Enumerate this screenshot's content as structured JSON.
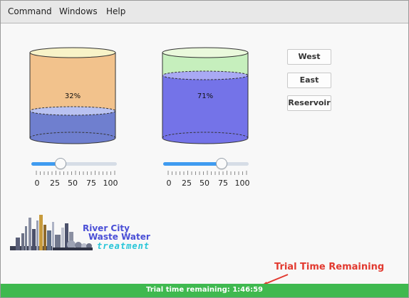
{
  "menubar": {
    "items": [
      {
        "label": "Command"
      },
      {
        "label": "Windows"
      },
      {
        "label": "Help"
      }
    ]
  },
  "tanks": [
    {
      "name": "west-tank",
      "percent_label": "32%",
      "level": 0.32,
      "colors": {
        "liquid": "#6f7fcf",
        "liquid_top": "#aab5ee",
        "empty": "#f2c28c",
        "rim": "#f7f2c4"
      }
    },
    {
      "name": "east-tank",
      "percent_label": "71%",
      "level": 0.71,
      "colors": {
        "liquid": "#7473e8",
        "liquid_top": "#a7a7f3",
        "empty": "#c6efbd",
        "rim": "#e8f8d8"
      }
    }
  ],
  "sliders": [
    {
      "value": 0.32,
      "ticks": [
        "0",
        "25",
        "50",
        "75",
        "100"
      ]
    },
    {
      "value": 0.71,
      "ticks": [
        "0",
        "25",
        "50",
        "75",
        "100"
      ]
    }
  ],
  "buttons": {
    "west": "West",
    "east": "East",
    "reservoir": "Reservoir"
  },
  "logo": {
    "line1": "River City",
    "line2": "Waste Water",
    "line3": "treatment"
  },
  "annotation": "Trial Time Remaining",
  "status_bar": {
    "text": "Trial time remaining: 1:46:59",
    "color": "#3fb94f"
  }
}
